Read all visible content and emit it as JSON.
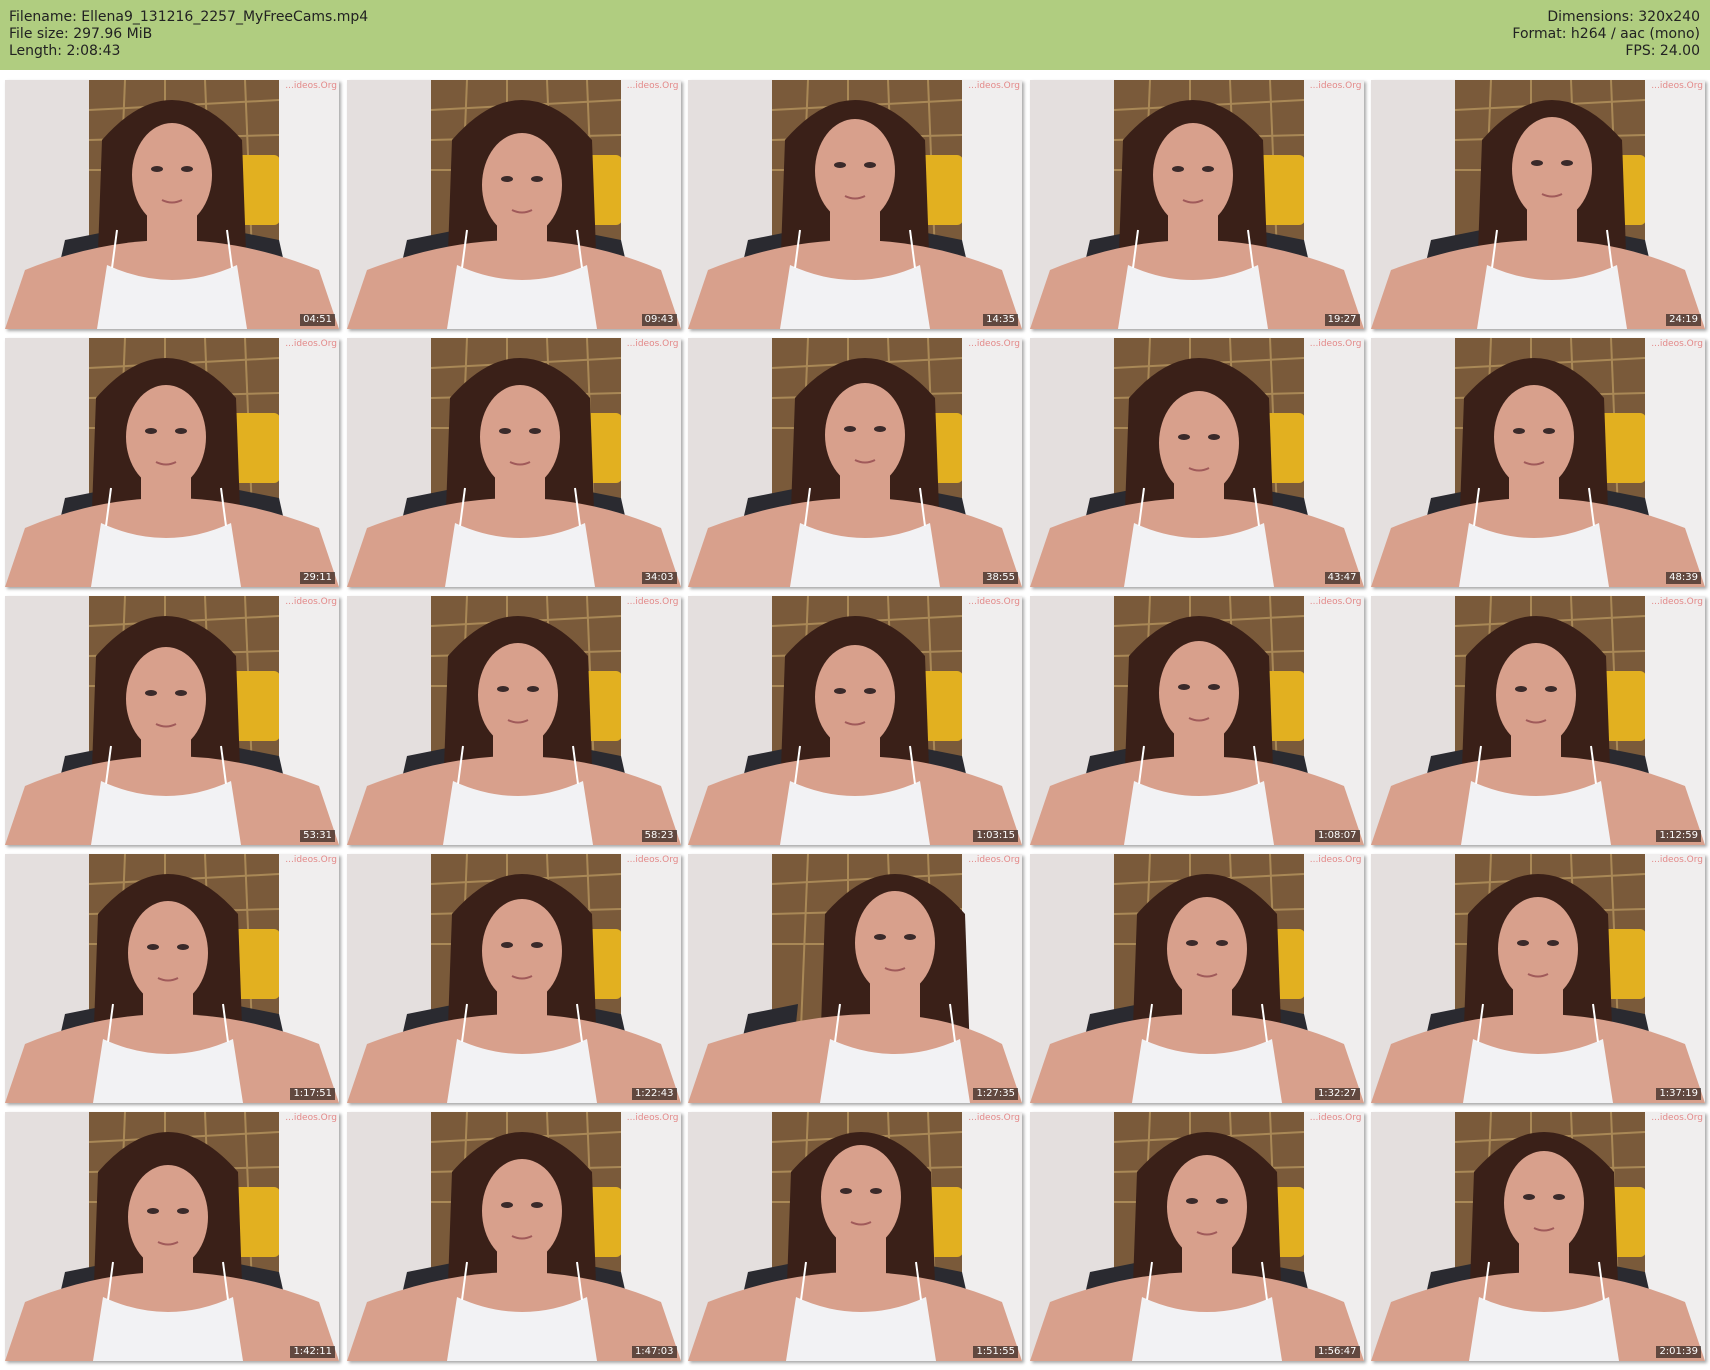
{
  "header": {
    "filename": "Filename: Ellena9_131216_2257_MyFreeCams.mp4",
    "file_size": "File size: 297.96 MiB",
    "length": "Length: 2:08:43",
    "dimensions": "Dimensions: 320x240",
    "format": "Format: h264 / aac (mono)",
    "fps": "FPS: 24.00"
  },
  "watermark": "...ideos.Org",
  "thumbnails": [
    {
      "time": "04:51"
    },
    {
      "time": "09:43"
    },
    {
      "time": "14:35"
    },
    {
      "time": "19:27"
    },
    {
      "time": "24:19"
    },
    {
      "time": "29:11"
    },
    {
      "time": "34:03"
    },
    {
      "time": "38:55"
    },
    {
      "time": "43:47"
    },
    {
      "time": "48:39"
    },
    {
      "time": "53:31"
    },
    {
      "time": "58:23"
    },
    {
      "time": "1:03:15"
    },
    {
      "time": "1:08:07"
    },
    {
      "time": "1:12:59"
    },
    {
      "time": "1:17:51"
    },
    {
      "time": "1:22:43"
    },
    {
      "time": "1:27:35"
    },
    {
      "time": "1:32:27"
    },
    {
      "time": "1:37:19"
    },
    {
      "time": "1:42:11"
    },
    {
      "time": "1:47:03"
    },
    {
      "time": "1:51:55"
    },
    {
      "time": "1:56:47"
    },
    {
      "time": "2:01:39"
    }
  ],
  "colors": {
    "header_bg": "#b0cd80",
    "wall": "#e4dfde",
    "poster": "#7a5a3a",
    "bus": "#e2b020",
    "hair": "#3a2018",
    "skin": "#d8a08c",
    "top": "#f2f2f4",
    "chair": "#2a2a30"
  }
}
